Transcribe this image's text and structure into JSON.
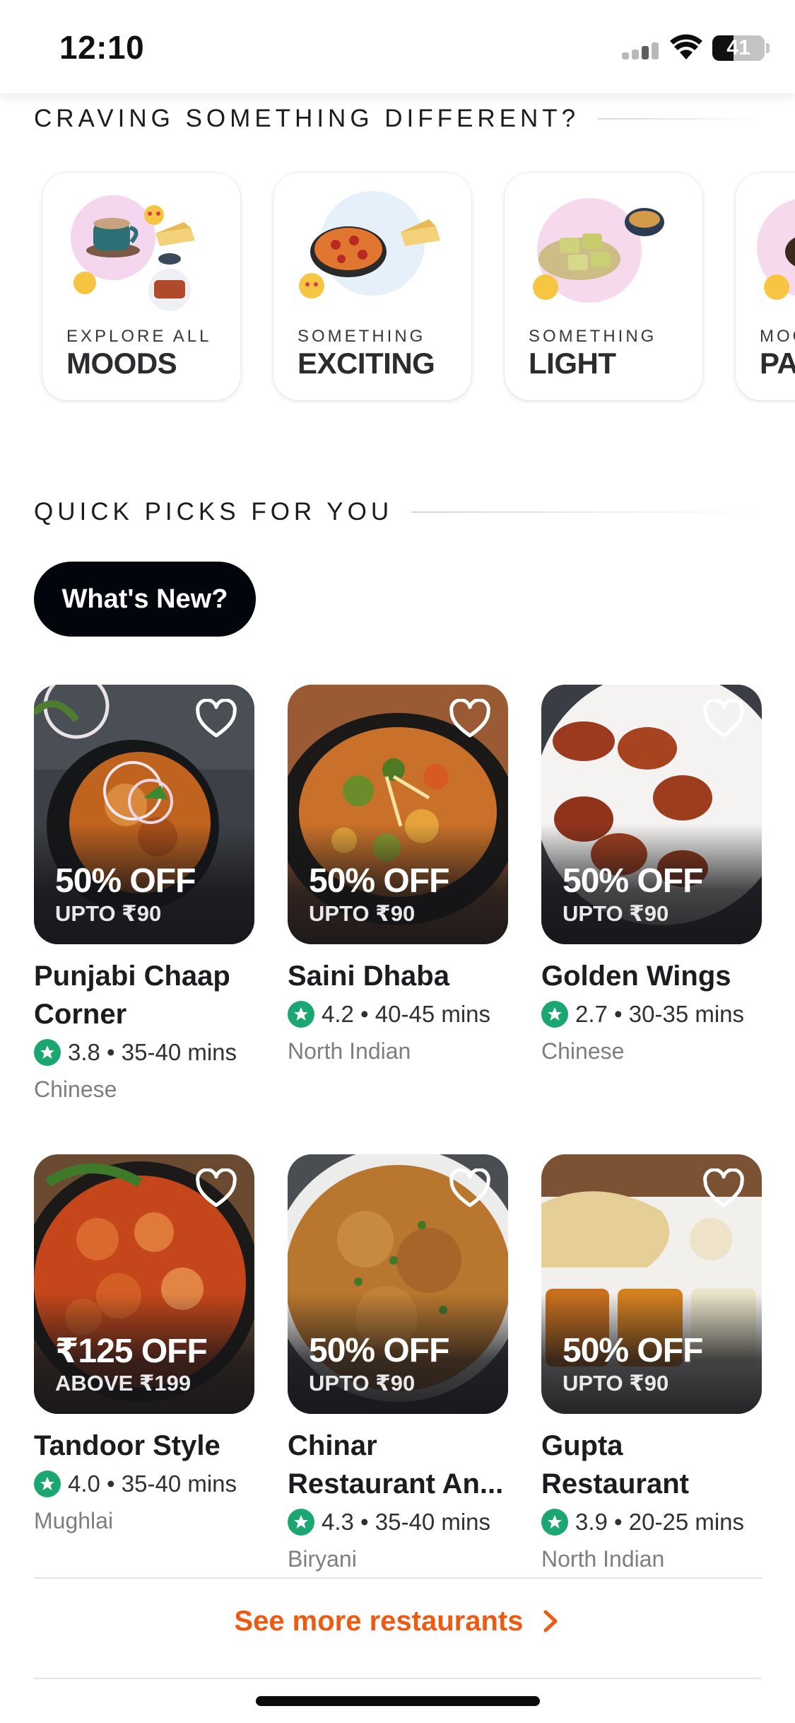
{
  "status_bar": {
    "time": "12:10",
    "battery": "41",
    "battery_level": 0.41
  },
  "sections": {
    "craving": "CRAVING SOMETHING DIFFERENT?",
    "quick_picks": "QUICK PICKS FOR YOU"
  },
  "moods": [
    {
      "small": "EXPLORE ALL",
      "big": "MOODS"
    },
    {
      "small": "SOMETHING",
      "big": "EXCITING"
    },
    {
      "small": "SOMETHING",
      "big": "LIGHT"
    },
    {
      "small": "MOO",
      "big": "PA"
    }
  ],
  "filter_pill": "What's New?",
  "restaurants": [
    {
      "name": "Punjabi Chaap Corner",
      "offer": "50% OFF",
      "offer_sub": "UPTO ₹90",
      "rating": "3.8",
      "time": "35-40 mins",
      "cuisine": "Chinese"
    },
    {
      "name": "Saini Dhaba",
      "offer": "50% OFF",
      "offer_sub": "UPTO ₹90",
      "rating": "4.2",
      "time": "40-45 mins",
      "cuisine": "North Indian"
    },
    {
      "name": "Golden Wings",
      "offer": "50% OFF",
      "offer_sub": "UPTO ₹90",
      "rating": "2.7",
      "time": "30-35 mins",
      "cuisine": "Chinese"
    },
    {
      "name": "Tandoor Style",
      "offer": "₹125 OFF",
      "offer_sub": "ABOVE ₹199",
      "rating": "4.0",
      "time": "35-40 mins",
      "cuisine": "Mughlai"
    },
    {
      "name": "Chinar Restaurant An...",
      "offer": "50% OFF",
      "offer_sub": "UPTO ₹90",
      "rating": "4.3",
      "time": "35-40 mins",
      "cuisine": "Biryani"
    },
    {
      "name": "Gupta Restaurant",
      "offer": "50% OFF",
      "offer_sub": "UPTO ₹90",
      "rating": "3.9",
      "time": "20-25 mins",
      "cuisine": "North Indian"
    }
  ],
  "see_more": "See more restaurants",
  "colors": {
    "accent": "#ef5a13",
    "rating_green": "#1ba672",
    "pill_bg": "#02060c"
  },
  "icons": [
    "signal-icon",
    "wifi-icon",
    "battery-icon",
    "heart-icon",
    "star-icon",
    "chevron-right-icon"
  ]
}
